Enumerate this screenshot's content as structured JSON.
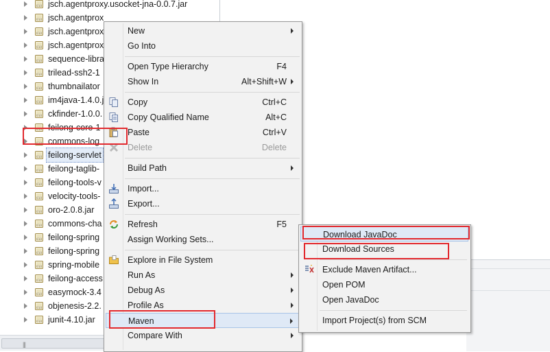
{
  "tree": {
    "items": [
      {
        "label": "jsch.agentproxy.usocket-jna-0.0.7.jar"
      },
      {
        "label": "jsch.agentprox"
      },
      {
        "label": "jsch.agentprox"
      },
      {
        "label": "jsch.agentprox"
      },
      {
        "label": "sequence-libra"
      },
      {
        "label": "trilead-ssh2-1"
      },
      {
        "label": "thumbnailator"
      },
      {
        "label": "im4java-1.4.0.j"
      },
      {
        "label": "ckfinder-1.0.0."
      },
      {
        "label": "feilong-core-1"
      },
      {
        "label": "commons-log"
      },
      {
        "label": "feilong-servlet"
      },
      {
        "label": "feilong-taglib-"
      },
      {
        "label": "feilong-tools-v"
      },
      {
        "label": "velocity-tools-"
      },
      {
        "label": "oro-2.0.8.jar"
      },
      {
        "label": "commons-cha"
      },
      {
        "label": "feilong-spring"
      },
      {
        "label": "feilong-spring"
      },
      {
        "label": "spring-mobile"
      },
      {
        "label": "feilong-access"
      },
      {
        "label": "easymock-3.4"
      },
      {
        "label": "objenesis-2.2."
      },
      {
        "label": "junit-4.10.jar"
      }
    ],
    "scroll_grip": "|||"
  },
  "context_menu": {
    "items": [
      {
        "label": "New",
        "accel": "",
        "submenu": true
      },
      {
        "label": "Go Into",
        "accel": "",
        "submenu": false
      },
      {
        "label": "Open Type Hierarchy",
        "accel": "F4",
        "submenu": false
      },
      {
        "label": "Show In",
        "accel": "Alt+Shift+W",
        "submenu": true
      },
      {
        "label": "Copy",
        "accel": "Ctrl+C",
        "submenu": false,
        "icon": "copy-icon"
      },
      {
        "label": "Copy Qualified Name",
        "accel": "Alt+C",
        "submenu": false,
        "icon": "copy-qualified-name-icon"
      },
      {
        "label": "Paste",
        "accel": "Ctrl+V",
        "submenu": false,
        "icon": "paste-icon"
      },
      {
        "label": "Delete",
        "accel": "Delete",
        "submenu": false,
        "icon": "delete-icon",
        "disabled": true
      },
      {
        "label": "Build Path",
        "accel": "",
        "submenu": true
      },
      {
        "label": "Import...",
        "accel": "",
        "submenu": false,
        "icon": "import-icon"
      },
      {
        "label": "Export...",
        "accel": "",
        "submenu": false,
        "icon": "export-icon"
      },
      {
        "label": "Refresh",
        "accel": "F5",
        "submenu": false,
        "icon": "refresh-icon"
      },
      {
        "label": "Assign Working Sets...",
        "accel": "",
        "submenu": false
      },
      {
        "label": "Explore in File System",
        "accel": "",
        "submenu": false,
        "icon": "folder-icon"
      },
      {
        "label": "Run As",
        "accel": "",
        "submenu": true
      },
      {
        "label": "Debug As",
        "accel": "",
        "submenu": true
      },
      {
        "label": "Profile As",
        "accel": "",
        "submenu": true
      },
      {
        "label": "Maven",
        "accel": "",
        "submenu": true,
        "highlighted": true
      },
      {
        "label": "Compare With",
        "accel": "",
        "submenu": true
      }
    ]
  },
  "maven_submenu": {
    "items": [
      {
        "label": "Download JavaDoc"
      },
      {
        "label": "Download Sources"
      },
      {
        "label": "Exclude Maven Artifact...",
        "icon": "exclude-artifact-icon"
      },
      {
        "label": "Open POM"
      },
      {
        "label": "Open JavaDoc"
      },
      {
        "label": "Import Project(s) from SCM"
      }
    ]
  },
  "colors": {
    "highlight_box": "#e2282d",
    "hover_bg": "#dfe9f6",
    "menu_bg": "#f2f2f2"
  }
}
